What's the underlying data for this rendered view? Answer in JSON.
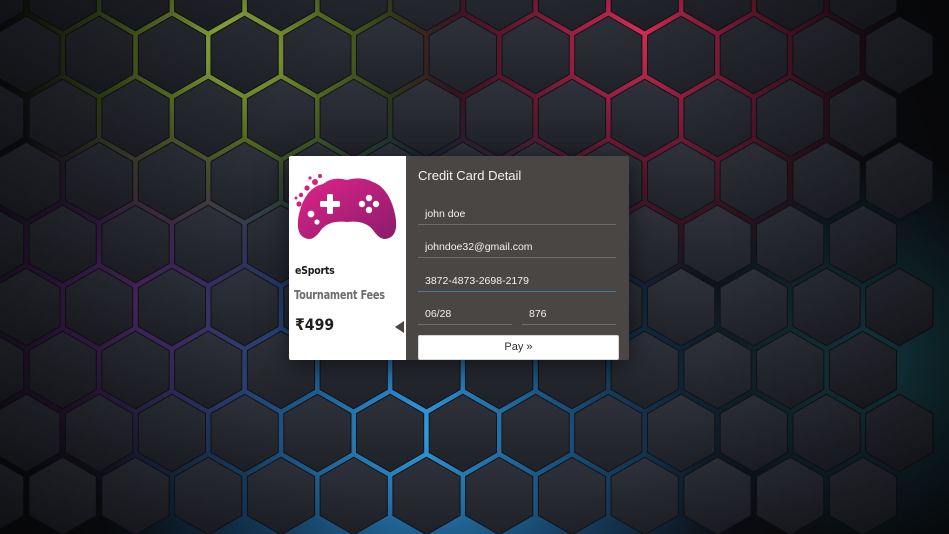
{
  "theme": {
    "background": "#15171c",
    "hex_fill": "#262830",
    "glow_colors": [
      "#9ec43b",
      "#e23b5b",
      "#2b8fd6",
      "#7b3fa0"
    ],
    "card_right_bg": "#4a4643",
    "brand_pink": "#c2166f"
  },
  "product": {
    "logo_icon": "gamepad-icon",
    "title": "eSports",
    "subtitle": "Tournament Fees",
    "price": "₹499"
  },
  "form": {
    "title": "Credit Card Detail",
    "name_value": "john doe",
    "email_value": "johndoe32@gmail.com",
    "card_number_value": "3872-4873-2698-2179",
    "expiry_value": "06/28",
    "cvv_value": "876",
    "pay_label": "Pay »"
  }
}
